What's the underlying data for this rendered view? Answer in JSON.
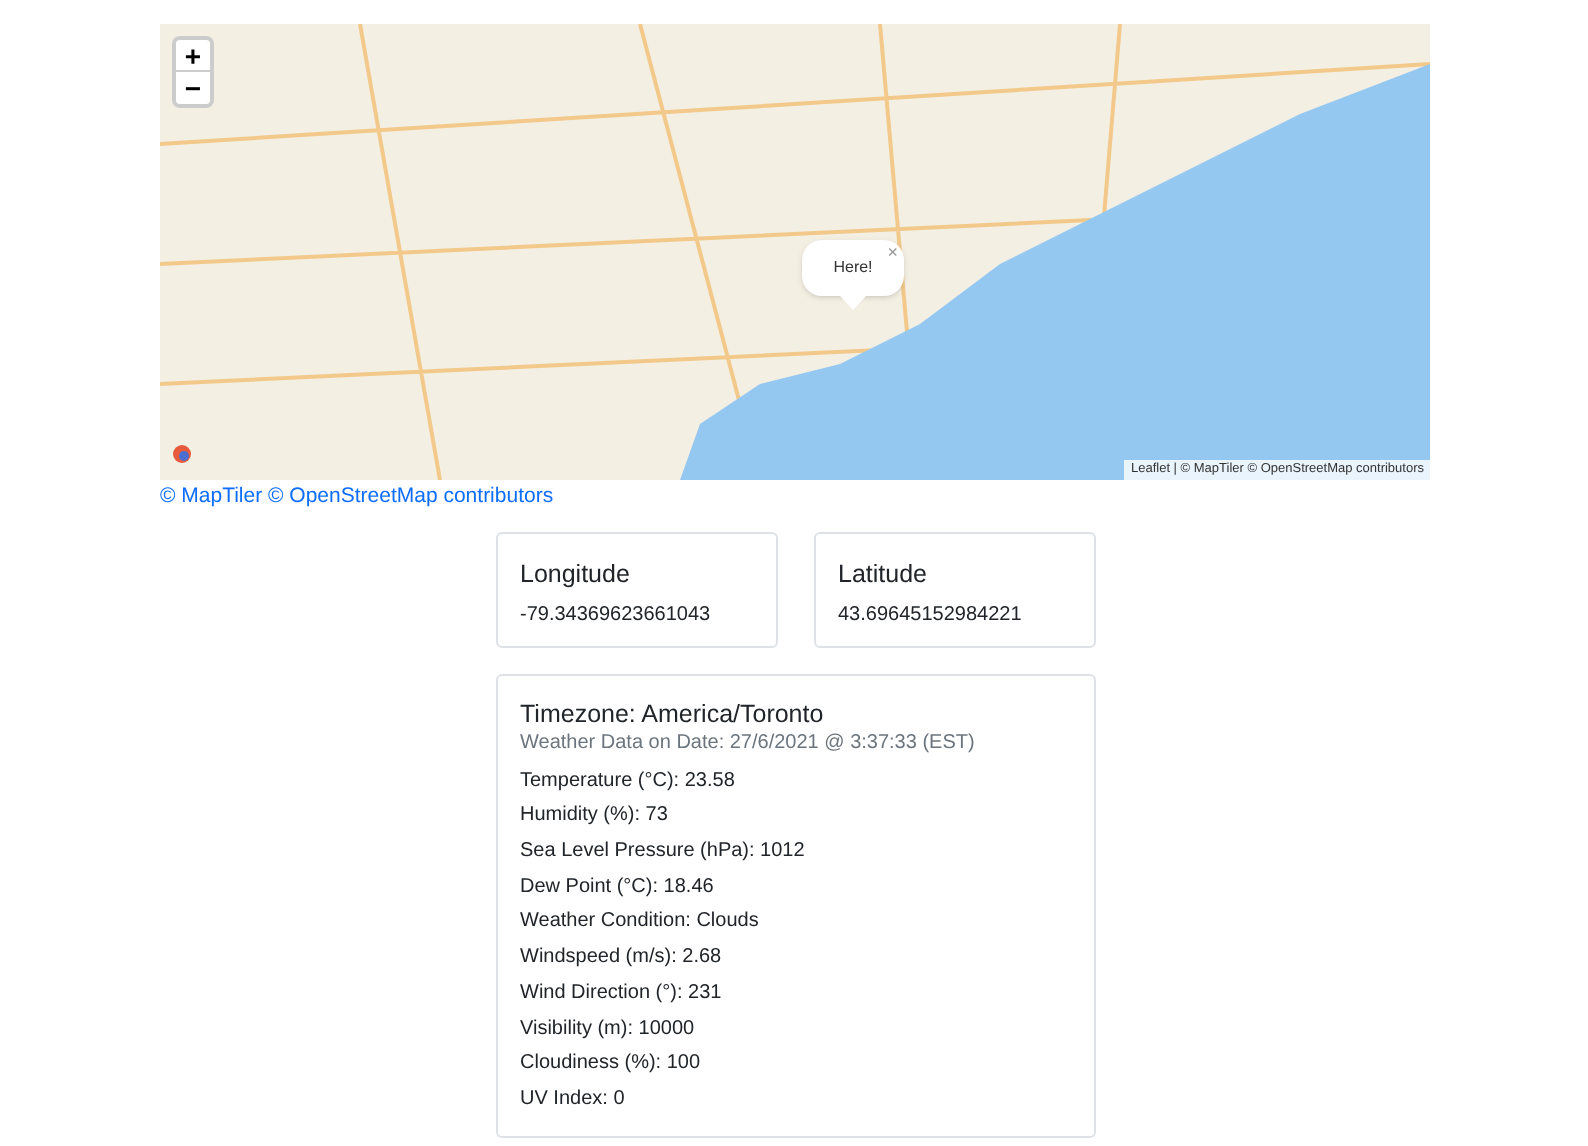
{
  "map": {
    "zoom_buttons": [
      "+",
      "−"
    ],
    "popup": {
      "text": "Here!",
      "close": "×"
    },
    "attribution": "Leaflet | © MapTiler © OpenStreetMap contributors"
  },
  "credit": "© MapTiler © OpenStreetMap contributors",
  "coordinates": [
    {
      "title": "Longitude",
      "value": "-79.34369623661043"
    },
    {
      "title": "Latitude",
      "value": "43.69645152984221"
    }
  ],
  "weather": {
    "title": "Timezone: America/Toronto",
    "subtitle": "Weather Data on Date: 27/6/2021 @ 3:37:33 (EST)",
    "rows": [
      "Temperature (°C): 23.58",
      "Humidity (%): 73",
      "Sea Level Pressure (hPa): 1012",
      "Dew Point (°C): 18.46",
      "Weather Condition: Clouds",
      "Windspeed (m/s): 2.68",
      "Wind Direction (°): 231",
      "Visibility (m): 10000",
      "Cloudiness (%): 100",
      "UV Index: 0"
    ]
  }
}
